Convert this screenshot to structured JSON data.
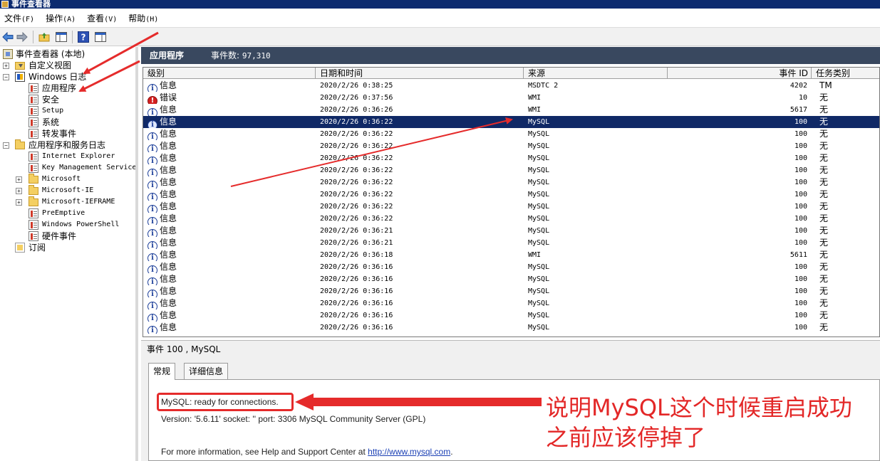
{
  "window": {
    "title": "事件查看器"
  },
  "menu": [
    {
      "label": "文件",
      "accel": "(F)"
    },
    {
      "label": "操作",
      "accel": "(A)"
    },
    {
      "label": "查看",
      "accel": "(V)"
    },
    {
      "label": "帮助",
      "accel": "(H)"
    }
  ],
  "tree": {
    "root": "事件查看器 (本地)",
    "custom_views": "自定义视图",
    "windows_logs": "Windows 日志",
    "windows_logs_children": [
      "应用程序",
      "安全",
      "Setup",
      "系统",
      "转发事件"
    ],
    "app_service_logs": "应用程序和服务日志",
    "app_service_children": [
      "Internet Explorer",
      "Key Management Service",
      "Microsoft",
      "Microsoft-IE",
      "Microsoft-IEFRAME",
      "PreEmptive",
      "Windows PowerShell",
      "硬件事件"
    ],
    "subscriptions": "订阅"
  },
  "log_header": {
    "title": "应用程序",
    "count_label": "事件数:",
    "count": "97,310"
  },
  "columns": {
    "level": "级别",
    "datetime": "日期和时间",
    "source": "来源",
    "event_id": "事件 ID",
    "task": "任务类别"
  },
  "rows": [
    {
      "level": "信息",
      "type": "info",
      "datetime": "2020/2/26 0:38:25",
      "source": "MSDTC 2",
      "event_id": "4202",
      "task": "TM"
    },
    {
      "level": "错误",
      "type": "error",
      "datetime": "2020/2/26 0:37:56",
      "source": "WMI",
      "event_id": "10",
      "task": "无"
    },
    {
      "level": "信息",
      "type": "info",
      "datetime": "2020/2/26 0:36:26",
      "source": "WMI",
      "event_id": "5617",
      "task": "无"
    },
    {
      "level": "信息",
      "type": "info",
      "datetime": "2020/2/26 0:36:22",
      "source": "MySQL",
      "event_id": "100",
      "task": "无",
      "selected": true
    },
    {
      "level": "信息",
      "type": "info",
      "datetime": "2020/2/26 0:36:22",
      "source": "MySQL",
      "event_id": "100",
      "task": "无"
    },
    {
      "level": "信息",
      "type": "info",
      "datetime": "2020/2/26 0:36:22",
      "source": "MySQL",
      "event_id": "100",
      "task": "无"
    },
    {
      "level": "信息",
      "type": "info",
      "datetime": "2020/2/26 0:36:22",
      "source": "MySQL",
      "event_id": "100",
      "task": "无"
    },
    {
      "level": "信息",
      "type": "info",
      "datetime": "2020/2/26 0:36:22",
      "source": "MySQL",
      "event_id": "100",
      "task": "无"
    },
    {
      "level": "信息",
      "type": "info",
      "datetime": "2020/2/26 0:36:22",
      "source": "MySQL",
      "event_id": "100",
      "task": "无"
    },
    {
      "level": "信息",
      "type": "info",
      "datetime": "2020/2/26 0:36:22",
      "source": "MySQL",
      "event_id": "100",
      "task": "无"
    },
    {
      "level": "信息",
      "type": "info",
      "datetime": "2020/2/26 0:36:22",
      "source": "MySQL",
      "event_id": "100",
      "task": "无"
    },
    {
      "level": "信息",
      "type": "info",
      "datetime": "2020/2/26 0:36:22",
      "source": "MySQL",
      "event_id": "100",
      "task": "无"
    },
    {
      "level": "信息",
      "type": "info",
      "datetime": "2020/2/26 0:36:21",
      "source": "MySQL",
      "event_id": "100",
      "task": "无"
    },
    {
      "level": "信息",
      "type": "info",
      "datetime": "2020/2/26 0:36:21",
      "source": "MySQL",
      "event_id": "100",
      "task": "无"
    },
    {
      "level": "信息",
      "type": "info",
      "datetime": "2020/2/26 0:36:18",
      "source": "WMI",
      "event_id": "5611",
      "task": "无"
    },
    {
      "level": "信息",
      "type": "info",
      "datetime": "2020/2/26 0:36:16",
      "source": "MySQL",
      "event_id": "100",
      "task": "无"
    },
    {
      "level": "信息",
      "type": "info",
      "datetime": "2020/2/26 0:36:16",
      "source": "MySQL",
      "event_id": "100",
      "task": "无"
    },
    {
      "level": "信息",
      "type": "info",
      "datetime": "2020/2/26 0:36:16",
      "source": "MySQL",
      "event_id": "100",
      "task": "无"
    },
    {
      "level": "信息",
      "type": "info",
      "datetime": "2020/2/26 0:36:16",
      "source": "MySQL",
      "event_id": "100",
      "task": "无"
    },
    {
      "level": "信息",
      "type": "info",
      "datetime": "2020/2/26 0:36:16",
      "source": "MySQL",
      "event_id": "100",
      "task": "无"
    },
    {
      "level": "信息",
      "type": "info",
      "datetime": "2020/2/26 0:36:16",
      "source": "MySQL",
      "event_id": "100",
      "task": "无"
    }
  ],
  "detail": {
    "header": "事件 100 , MySQL",
    "tabs": [
      "常规",
      "详细信息"
    ],
    "message_line1": "MySQL: ready for connections.",
    "message_line2": "Version: '5.6.11'  socket: ''  port: 3306  MySQL Community Server (GPL)",
    "help_text": "For more information, see Help and Support Center at",
    "help_link": "http://www.mysql.com",
    "help_end": "."
  },
  "annotation": {
    "note_line1": "说明MySQL这个时候重启成功",
    "note_line2": "之前应该停掉了",
    "color": "#e52b2b"
  },
  "colors": {
    "header_bg": "#39485f",
    "selected_row": "#102966",
    "title_bar": "#0b2a6f"
  }
}
